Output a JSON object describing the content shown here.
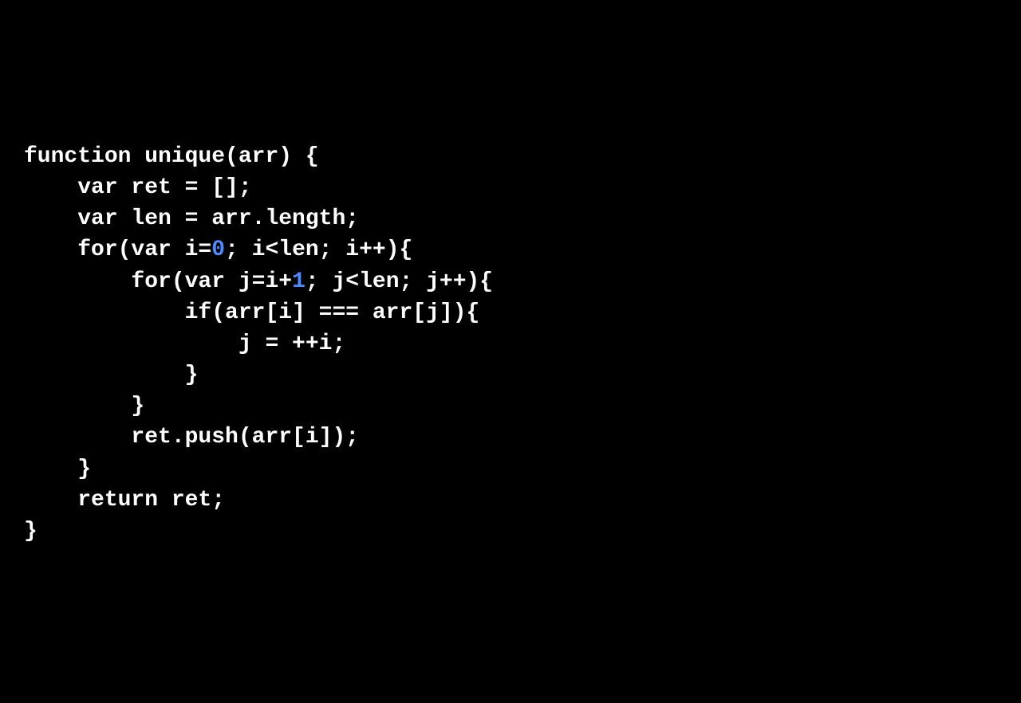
{
  "code": {
    "line1_part1": "function unique(arr) {",
    "line2": "    var ret = [];",
    "line3": "    var len = arr.length;",
    "line4_part1": "    for(var i=",
    "line4_highlight": "0",
    "line4_part2": "; i<len; i++){",
    "line5_part1": "        for(var j=i+",
    "line5_highlight": "1",
    "line5_part2": "; j<len; j++){",
    "line6": "            if(arr[i] === arr[j]){",
    "line7": "                j = ++i;",
    "line8": "            }",
    "line9": "        }",
    "line10": "        ret.push(arr[i]);",
    "line11": "    }",
    "line12": "    return ret;",
    "line13": "}"
  }
}
